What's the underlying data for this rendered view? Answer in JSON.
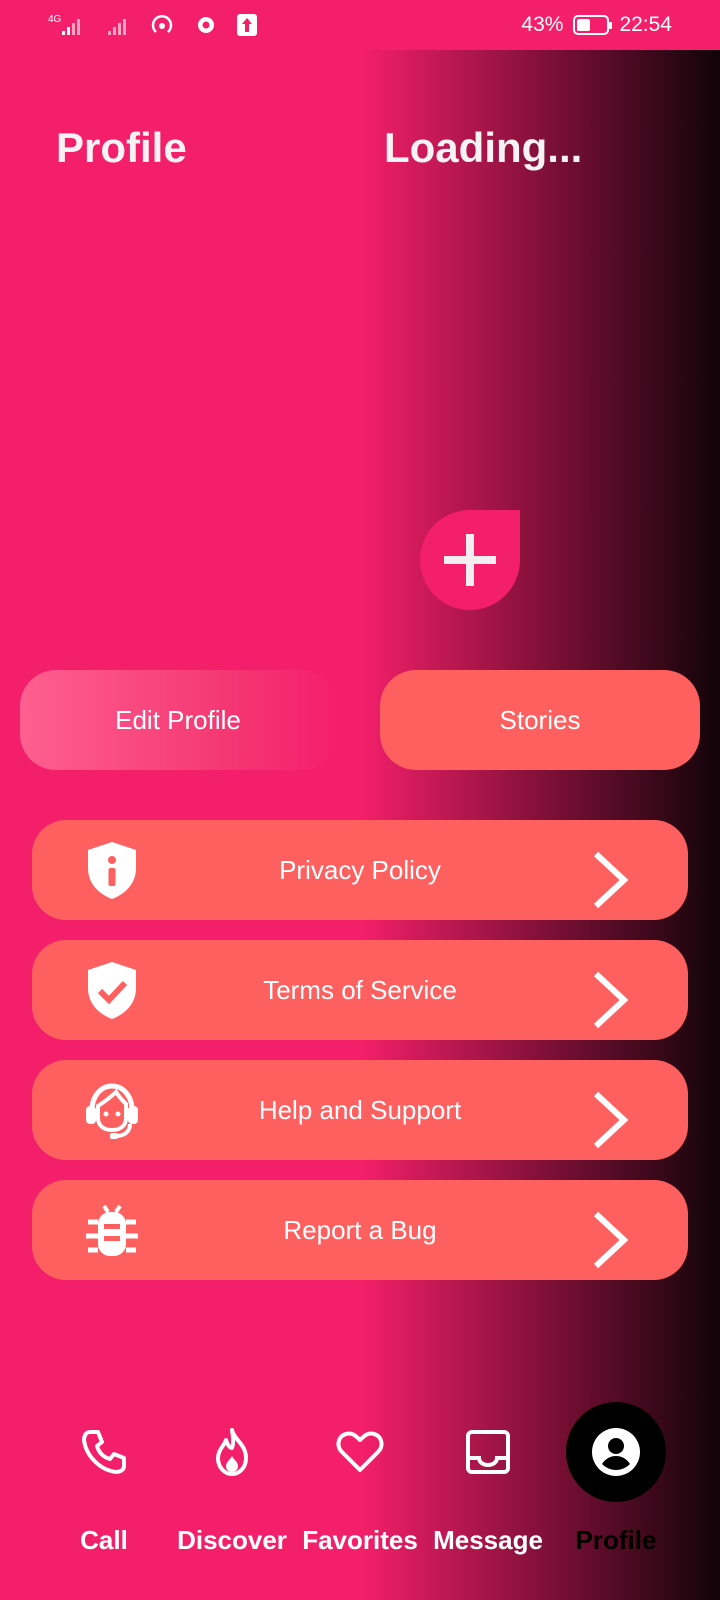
{
  "status": {
    "battery": "43%",
    "time": "22:54",
    "network": "4G"
  },
  "header": {
    "title": "Profile",
    "name": "Loading..."
  },
  "actions": {
    "edit_profile": "Edit Profile",
    "stories": "Stories"
  },
  "menu": [
    {
      "label": "Privacy Policy",
      "icon": "shield-info-icon"
    },
    {
      "label": "Terms of Service",
      "icon": "shield-check-icon"
    },
    {
      "label": "Help and Support",
      "icon": "headset-agent-icon"
    },
    {
      "label": "Report a Bug",
      "icon": "bug-icon"
    }
  ],
  "nav": [
    {
      "label": "Call",
      "icon": "phone-icon"
    },
    {
      "label": "Discover",
      "icon": "flame-icon"
    },
    {
      "label": "Favorites",
      "icon": "heart-icon"
    },
    {
      "label": "Message",
      "icon": "inbox-icon"
    },
    {
      "label": "Profile",
      "icon": "account-circle-icon",
      "active": true
    }
  ],
  "colors": {
    "primary": "#f41f6a",
    "button": "#fe6060",
    "dark": "#110408"
  }
}
